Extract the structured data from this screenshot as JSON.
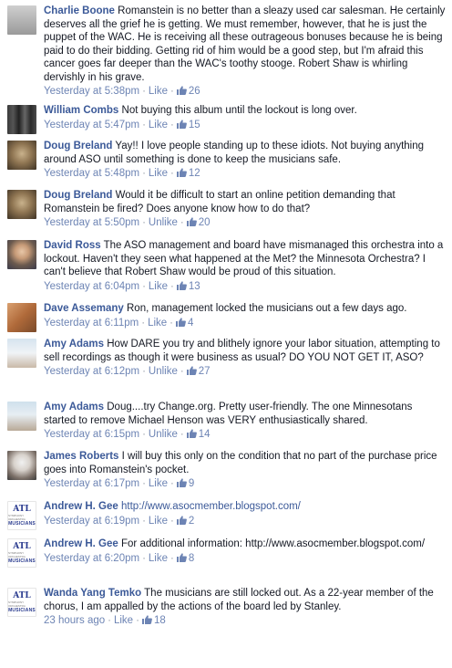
{
  "comments": [
    {
      "author": "Charlie Boone",
      "text": "Romanstein is no better than a sleazy used car salesman. He certainly deserves all the grief he is getting. We must remember, however, that he is just the puppet of the WAC. He is receiving all these outrageous bonuses because he is being paid to do their bidding. Getting rid of him would be a good step, but I'm afraid this cancer goes far deeper than the WAC's toothy stooge. Robert Shaw is whirling dervishly in his grave.",
      "time": "Yesterday at 5:38pm",
      "action": "Like",
      "likes": "26",
      "avatar": "gray-portrait"
    },
    {
      "author": "William Combs",
      "text": "Not buying this album until the lockout is long over.",
      "time": "Yesterday at 5:47pm",
      "action": "Like",
      "likes": "15",
      "avatar": "band-photo"
    },
    {
      "author": "Doug Breland",
      "text": "Yay!! I love people standing up to these idiots. Not buying anything around ASO until something is done to keep the musicians safe.",
      "time": "Yesterday at 5:48pm",
      "action": "Like",
      "likes": "12",
      "avatar": "cat-photo"
    },
    {
      "author": "Doug Breland",
      "text": "Would it be difficult to start an online petition demanding that Romanstein be fired? Does anyone know how to do that?",
      "time": "Yesterday at 5:50pm",
      "action": "Unlike",
      "likes": "20",
      "avatar": "cat-photo"
    },
    {
      "author": "David Ross",
      "text": "The ASO management and board have mismanaged this orchestra into a lockout. Haven't they seen what happened at the Met? the Minnesota Orchestra? I can't believe that Robert Shaw would be proud of this situation.",
      "time": "Yesterday at 6:04pm",
      "action": "Like",
      "likes": "13",
      "avatar": "man-portrait"
    },
    {
      "author": "Dave Assemany",
      "text": "Ron, management locked the musicians out a few days ago.",
      "time": "Yesterday at 6:11pm",
      "action": "Like",
      "likes": "4",
      "avatar": "group-photo"
    },
    {
      "author": "Amy Adams",
      "text": "How DARE you try and blithely ignore your labor situation, attempting to sell recordings as though it were business as usual? DO YOU NOT GET IT, ASO?",
      "time": "Yesterday at 6:12pm",
      "action": "Unlike",
      "likes": "27",
      "avatar": "sky-photo"
    },
    {
      "author": "Amy Adams",
      "text": "Doug....try Change.org. Pretty user-friendly. The one Minnesotans started to remove Michael Henson was VERY enthusiastically shared.",
      "time": "Yesterday at 6:15pm",
      "action": "Unlike",
      "likes": "14",
      "avatar": "beach-photo"
    },
    {
      "author": "James Roberts",
      "text": "I will buy this only on the condition that no part of the purchase price goes into Romanstein's pocket.",
      "time": "Yesterday at 6:17pm",
      "action": "Like",
      "likes": "9",
      "avatar": "elder-portrait"
    },
    {
      "author": "Andrew H. Gee",
      "text": "http://www.asocmember.blogspot.com/",
      "time": "Yesterday at 6:19pm",
      "action": "Like",
      "likes": "2",
      "avatar": "atl-logo"
    },
    {
      "author": "Andrew H. Gee",
      "text": "For additional information: http://www.asocmember.blogspot.com/",
      "time": "Yesterday at 6:20pm",
      "action": "Like",
      "likes": "8",
      "avatar": "atl-logo"
    },
    {
      "author": "Wanda Yang Temko",
      "text": "The musicians are still locked out. As a 22-year member of the chorus, I am appalled by the actions of the board led by Stanley.",
      "time": "23 hours ago",
      "action": "Like",
      "likes": "18",
      "avatar": "atl-logo"
    }
  ],
  "logo": {
    "top": "ATL",
    "middle": "SYMPHONY ORCHESTRA",
    "bottom": "MUSICIANS"
  },
  "colors": {
    "author": "#3b5998",
    "link": "#6d84b4",
    "meta": "#9197a3",
    "text": "#141823"
  },
  "separator": "·"
}
